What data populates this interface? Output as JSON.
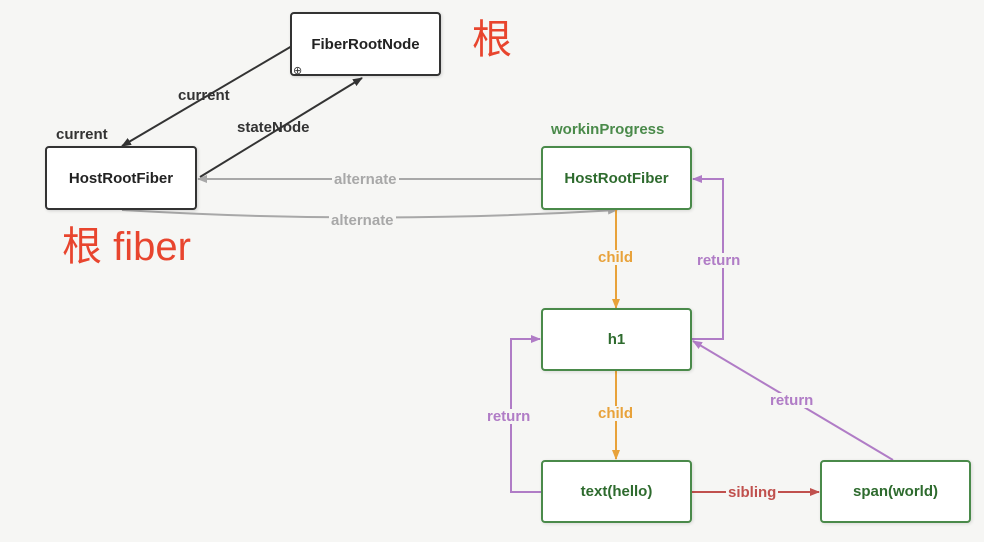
{
  "colors": {
    "black": "#333333",
    "gray": "#a8a8a8",
    "orange": "#e8a23a",
    "purple": "#b07cc6",
    "red": "#c0504d",
    "green_text": "#2e6b2e",
    "green_border": "#4a8a4a",
    "annotation_red": "#e8452e"
  },
  "nodes": {
    "fiber_root_node": "FiberRootNode",
    "current_host_root_fiber": "HostRootFiber",
    "wip_host_root_fiber": "HostRootFiber",
    "h1": "h1",
    "text_hello": "text(hello)",
    "span_world": "span(world)"
  },
  "labels": {
    "current_top": "current",
    "current_left": "current",
    "state_node": "stateNode",
    "workin_progress": "workinProgress",
    "alternate_top": "alternate",
    "alternate_bottom": "alternate",
    "child_1": "child",
    "child_2": "child",
    "return_1": "return",
    "return_2": "return",
    "return_3": "return",
    "sibling": "sibling"
  },
  "annotations": {
    "root": "根",
    "root_fiber": "根 fiber"
  },
  "icons": {
    "zoom": "zoom-in-icon"
  }
}
